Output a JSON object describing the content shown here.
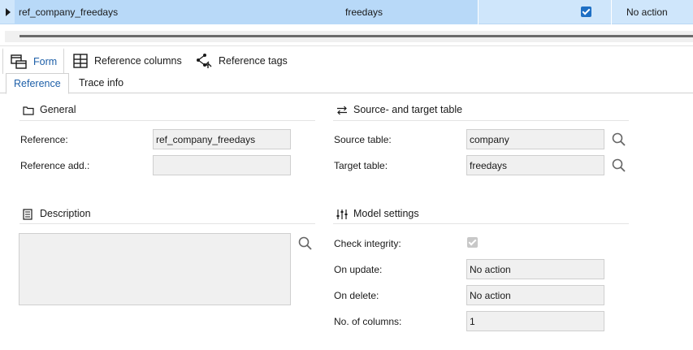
{
  "grid": {
    "row": {
      "reference": "ref_company_freedays",
      "target_table": "freedays",
      "check_integrity": true,
      "on_update": "No action"
    }
  },
  "main_tabs": [
    {
      "label": "Form",
      "icon": "form-icon"
    },
    {
      "label": "Reference columns",
      "icon": "table-icon"
    },
    {
      "label": "Reference tags",
      "icon": "tags-icon"
    }
  ],
  "sub_tabs": [
    {
      "label": "Reference"
    },
    {
      "label": "Trace info"
    }
  ],
  "general": {
    "title": "General",
    "reference_label": "Reference:",
    "reference_value": "ref_company_freedays",
    "reference_add_label": "Reference add.:",
    "reference_add_value": ""
  },
  "source_target": {
    "title": "Source- and target table",
    "source_label": "Source table:",
    "source_value": "company",
    "target_label": "Target table:",
    "target_value": "freedays"
  },
  "description": {
    "title": "Description",
    "value": ""
  },
  "model_settings": {
    "title": "Model settings",
    "check_integrity_label": "Check integrity:",
    "check_integrity": true,
    "on_update_label": "On update:",
    "on_update_value": "No action",
    "on_delete_label": "On delete:",
    "on_delete_value": "No action",
    "num_columns_label": "No. of columns:",
    "num_columns_value": "1"
  }
}
